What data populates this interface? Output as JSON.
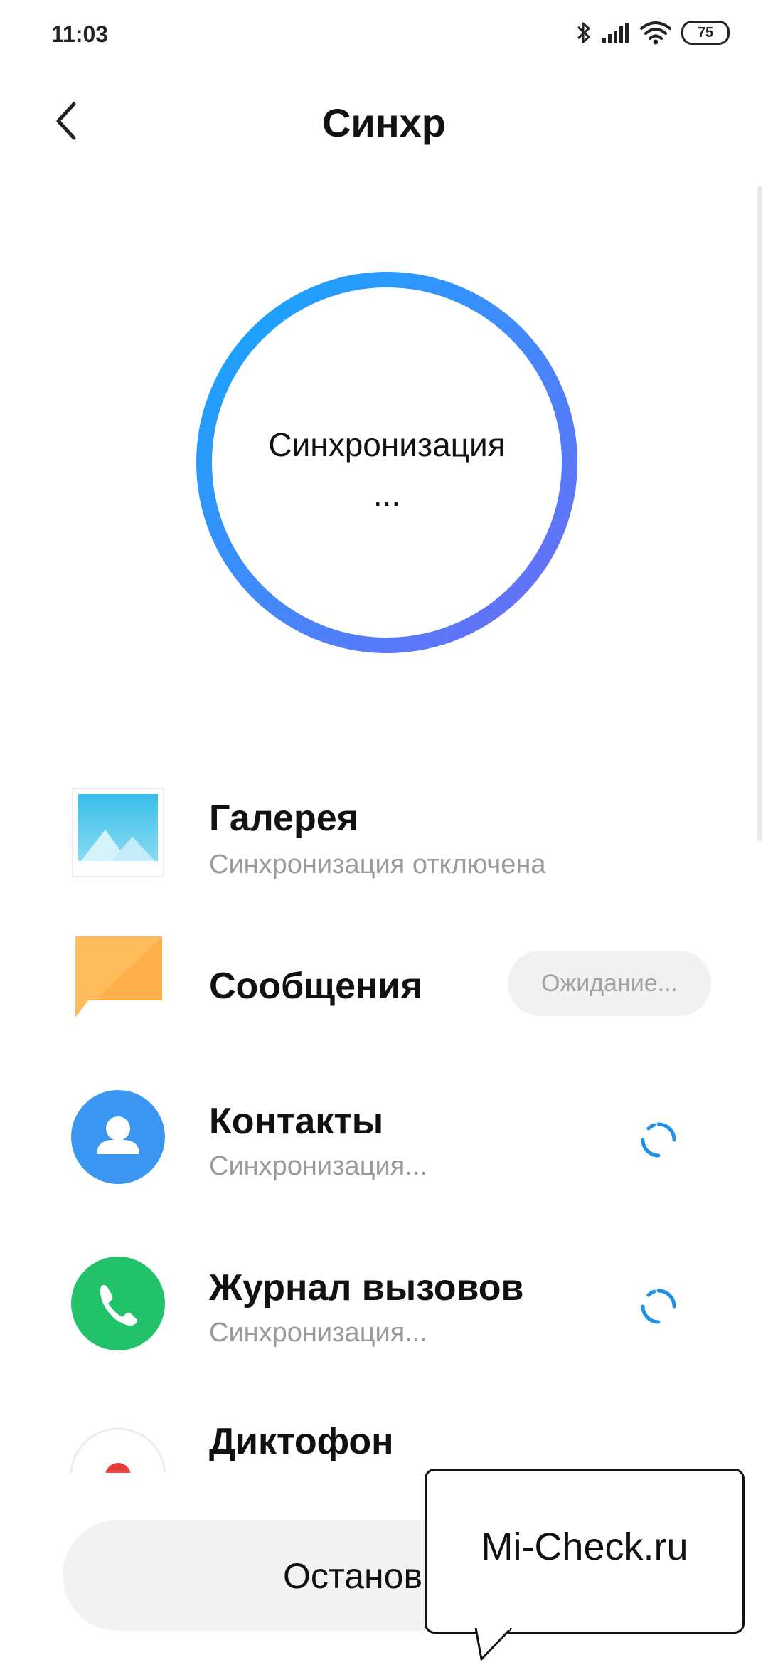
{
  "status_bar": {
    "time": "11:03",
    "battery": "75",
    "icons": [
      "bluetooth-icon",
      "signal-icon",
      "wifi-icon",
      "battery-icon"
    ]
  },
  "header": {
    "title": "Синхр",
    "back_icon": "back-arrow-icon"
  },
  "sync": {
    "status_line1": "Синхронизация",
    "status_line2": "...",
    "ring_gradient": [
      "#1aa7ff",
      "#6a6cf7"
    ]
  },
  "items": [
    {
      "icon": "gallery-icon",
      "title": "Галерея",
      "subtitle": "Синхронизация отключена"
    },
    {
      "icon": "messages-icon",
      "title": "Сообщения",
      "status": "Ожидание..."
    },
    {
      "icon": "contacts-icon",
      "title": "Контакты",
      "subtitle": "Синхронизация..."
    },
    {
      "icon": "phone-icon",
      "title": "Журнал вызовов",
      "subtitle": "Синхронизация..."
    },
    {
      "icon": "recorder-icon",
      "title": "Диктофон"
    }
  ],
  "bottom": {
    "stop_label": "Останов"
  },
  "watermark": {
    "text": "Mi-Check.ru"
  },
  "colors": {
    "contacts_blue": "#3a96f0",
    "phone_green": "#21c26a",
    "message_orange": "#ffbc5c",
    "spinner_blue": "#1e90e6"
  }
}
